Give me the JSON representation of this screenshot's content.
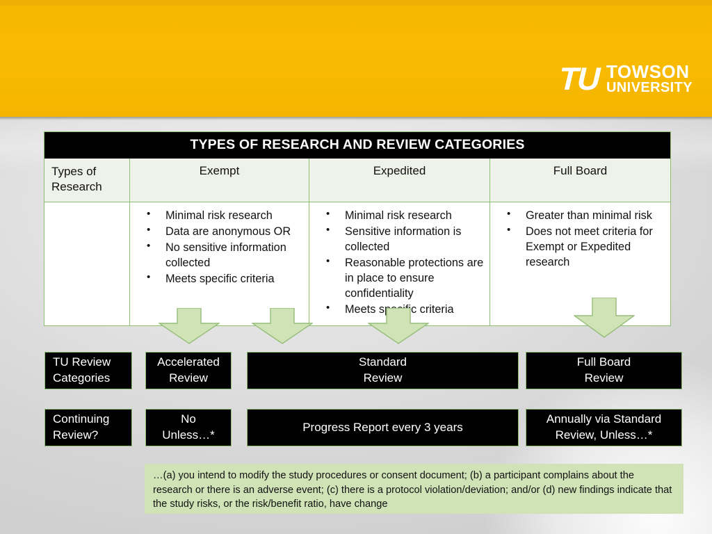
{
  "brand": {
    "logo_mark": "TU",
    "logo_line1": "TOWSON",
    "logo_line2": "UNIVERSITY",
    "gold": "#f8ba00",
    "green_fill": "#cfe3b6",
    "green_border": "#8cbf72"
  },
  "matrix": {
    "title": "TYPES OF RESEARCH AND REVIEW CATEGORIES",
    "headers": {
      "row_label": "Types of\nResearch",
      "col1": "Exempt",
      "col2": "Expedited",
      "col3": "Full Board"
    },
    "exempt_items": [
      "Minimal risk research",
      "Data are anonymous OR",
      "No sensitive information collected",
      "Meets specific criteria"
    ],
    "expedited_items": [
      "Minimal risk research",
      "Sensitive information is collected",
      "Reasonable protections are in place to ensure confidentiality",
      "Meets specific criteria"
    ],
    "fullboard_items": [
      "Greater than minimal risk",
      "Does not meet criteria for Exempt or Expedited research"
    ]
  },
  "review_row": {
    "label": "TU Review\nCategories",
    "accelerated": "Accelerated\nReview",
    "standard": "Standard\nReview",
    "full_board": "Full Board\nReview"
  },
  "continuing_row": {
    "label": "Continuing\nReview?",
    "accelerated": "No\nUnless…*",
    "standard": "Progress Report every 3 years",
    "full_board": "Annually via Standard\nReview, Unless…*"
  },
  "footnote": "…(a) you intend to modify the study procedures or consent document; (b) a participant complains about the research or there is an adverse event; (c) there is a protocol violation/deviation; and/or (d) new findings indicate that the study risks, or the risk/benefit ratio, have change"
}
